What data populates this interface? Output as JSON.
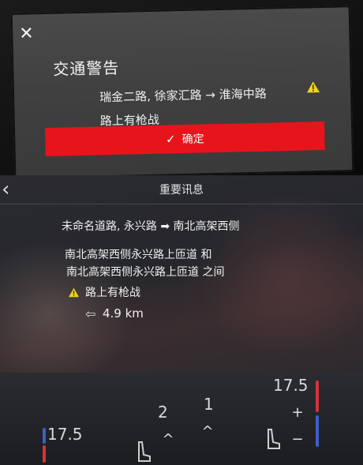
{
  "top_alert": {
    "close_symbol": "✕",
    "title": "交通警告",
    "route_text": "瑞金二路, 徐家汇路 → 淮海中路",
    "incident_text": "路上有枪战",
    "confirm_label": "确定",
    "confirm_color": "#e8141c",
    "icons": {
      "close": "close-icon",
      "warning": "warning-icon",
      "check": "check-icon"
    }
  },
  "bottom_message": {
    "header_title": "重要讯息",
    "route_text": "未命名道路, 永兴路 ➡ 南北高架西侧",
    "between_line1": "南北高架西侧永兴路上匝道 和",
    "between_line2": "南北高架西侧永兴路上匝道 之间",
    "incident_text": "路上有枪战",
    "distance": "4.9 km",
    "icons": {
      "back": "back-chevron-icon",
      "warning": "warning-icon",
      "distance": "distance-arrow-icon"
    }
  },
  "climate": {
    "temp_left": "17.5",
    "temp_right": "17.5",
    "fan_left": "2",
    "fan_right": "1",
    "plus": "+",
    "minus": "−",
    "up": "^"
  },
  "colors": {
    "warning": "#f2d21b",
    "alert_red": "#e8141c"
  }
}
